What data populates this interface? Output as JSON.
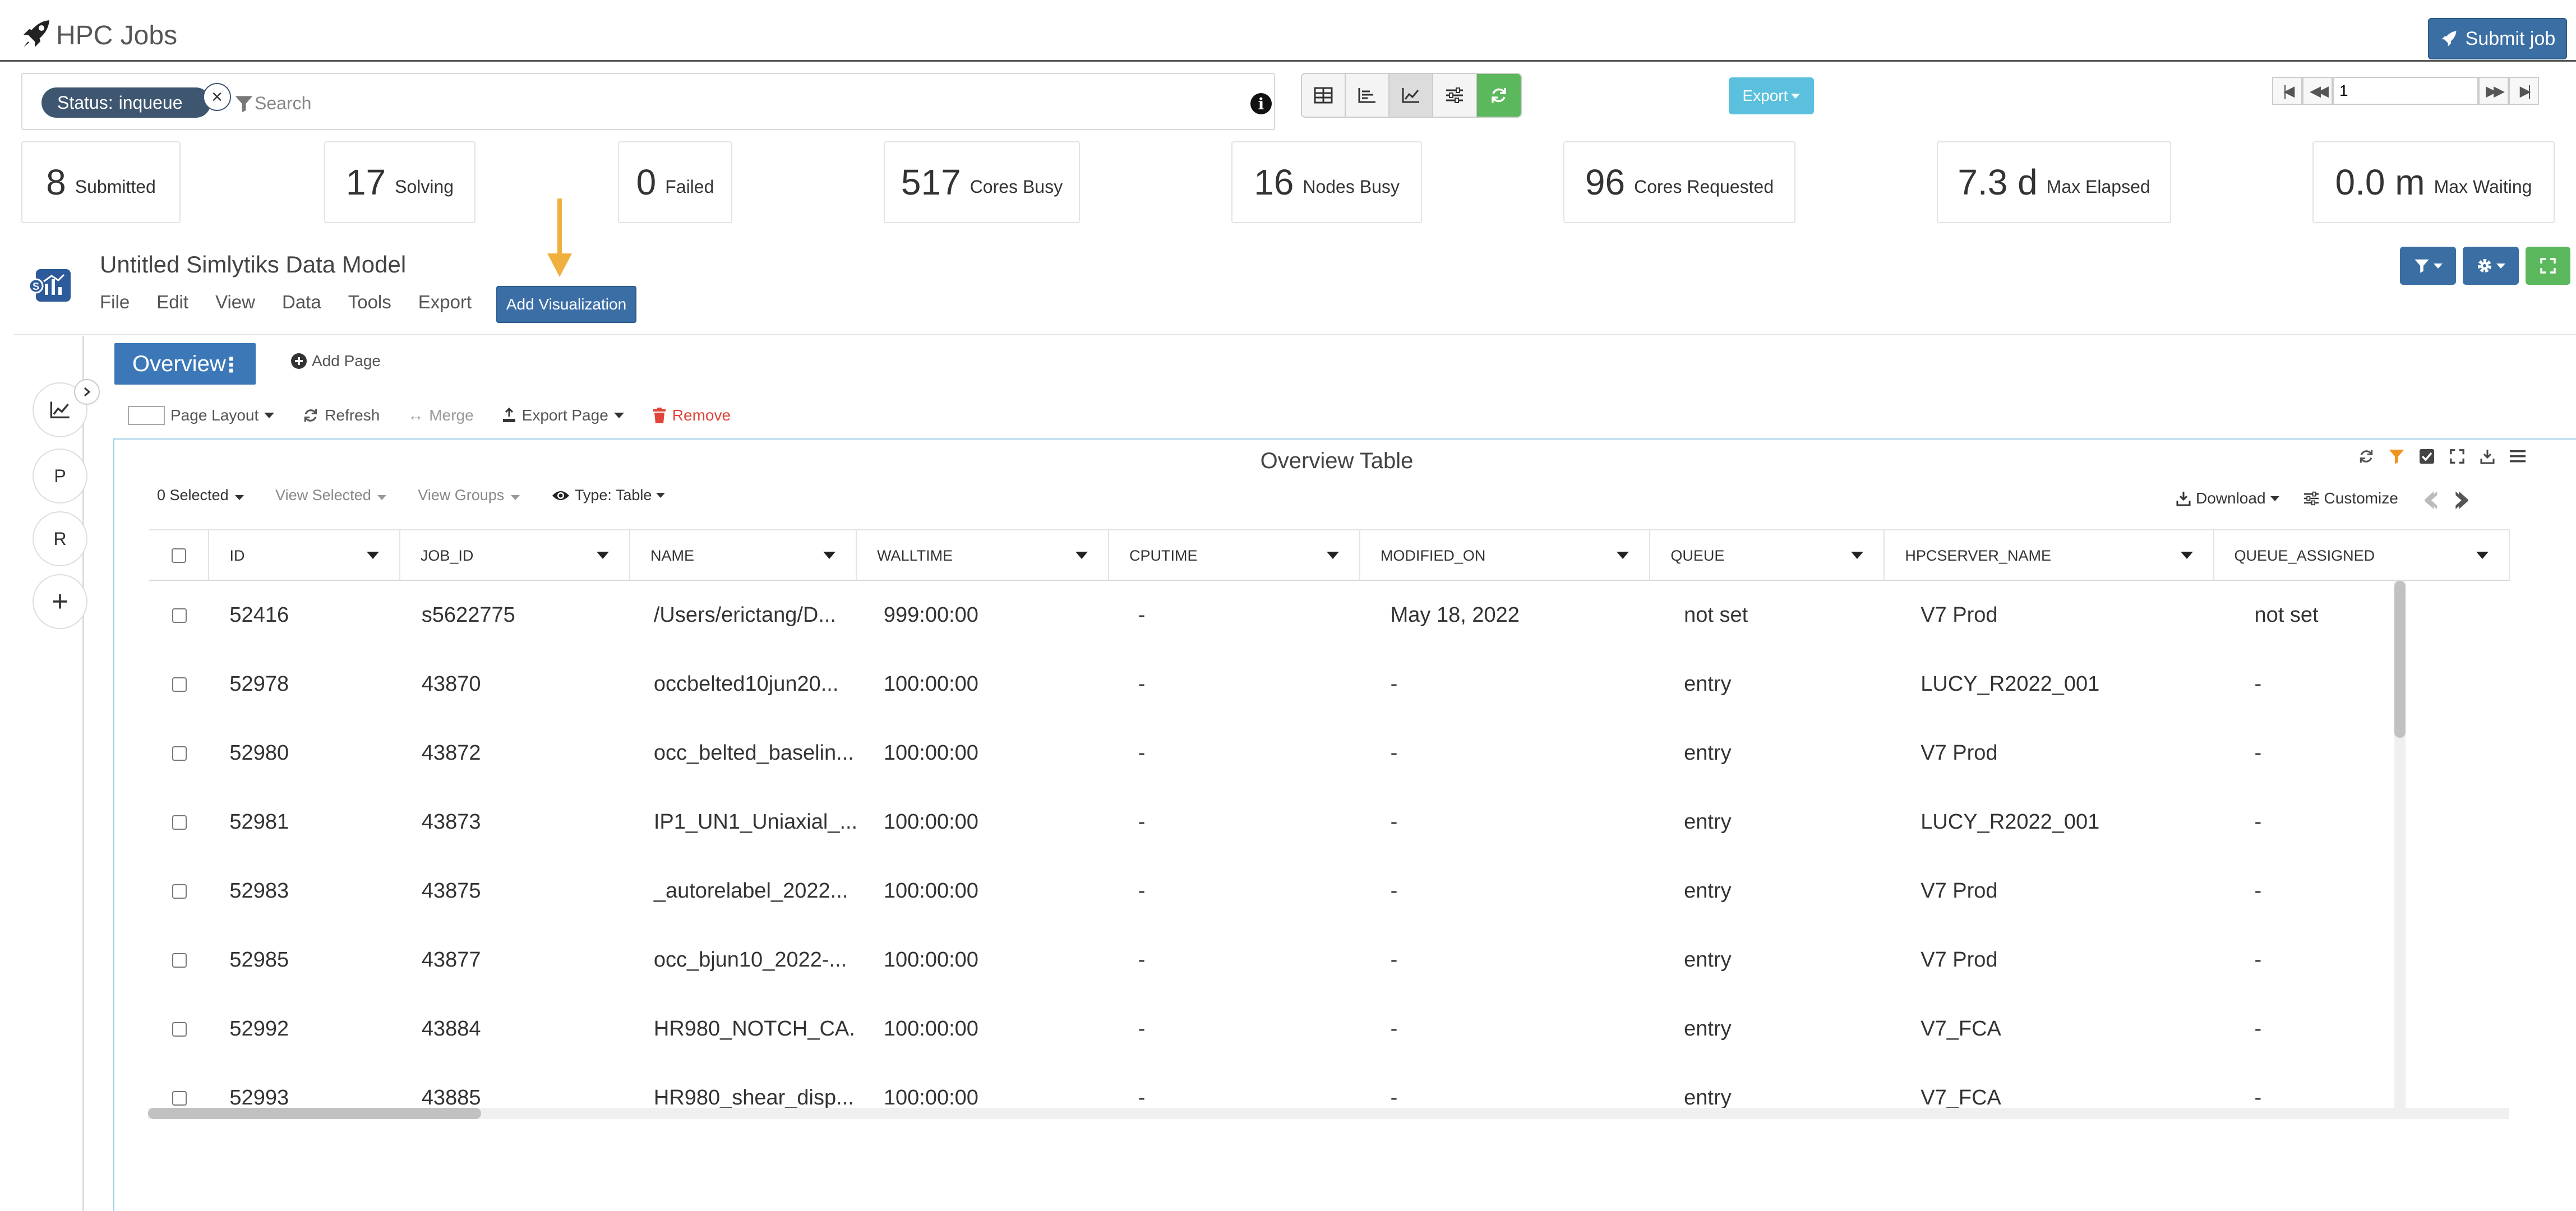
{
  "app": {
    "title": "HPC Jobs",
    "submit_label": "Submit job"
  },
  "search": {
    "chip_key": "Status:",
    "chip_value": "inqueue",
    "chip_close": "×",
    "placeholder": "Search"
  },
  "export": {
    "label": "Export"
  },
  "pager": {
    "page": "1"
  },
  "stats": [
    {
      "value": "8",
      "label": "Submitted"
    },
    {
      "value": "17",
      "label": "Solving"
    },
    {
      "value": "0",
      "label": "Failed"
    },
    {
      "value": "517",
      "label": "Cores Busy"
    },
    {
      "value": "16",
      "label": "Nodes Busy"
    },
    {
      "value": "96",
      "label": "Cores Requested"
    },
    {
      "value": "7.3 d",
      "label": "Max Elapsed"
    },
    {
      "value": "0.0 m",
      "label": "Max Waiting"
    }
  ],
  "model": {
    "title": "Untitled Simlytiks Data Model",
    "menu": [
      "File",
      "Edit",
      "View",
      "Data",
      "Tools",
      "Export"
    ],
    "add_viz": "Add Visualization"
  },
  "rail": {
    "p": "P",
    "r": "R",
    "plus": "+"
  },
  "page": {
    "tab": "Overview",
    "tab_menu": "⋮",
    "add_page": "Add Page",
    "toolbar": {
      "layout": "Page Layout",
      "refresh": "Refresh",
      "merge": "Merge",
      "export_page": "Export Page",
      "remove": "Remove"
    }
  },
  "widget": {
    "title": "Overview Table",
    "selected": "0 Selected",
    "view_selected": "View Selected",
    "view_groups": "View Groups",
    "type": "Type: Table",
    "download": "Download",
    "customize": "Customize"
  },
  "table": {
    "columns": [
      "ID",
      "JOB_ID",
      "NAME",
      "WALLTIME",
      "CPUTIME",
      "MODIFIED_ON",
      "QUEUE",
      "HPCSERVER_NAME",
      "QUEUE_ASSIGNED"
    ],
    "rows": [
      [
        "52416",
        "s5622775",
        "/Users/erictang/D...",
        "999:00:00",
        "-",
        "May 18, 2022",
        "not set",
        "V7 Prod",
        "not set"
      ],
      [
        "52978",
        "43870",
        "occbelted10jun20...",
        "100:00:00",
        "-",
        "-",
        "entry",
        "LUCY_R2022_001",
        "-"
      ],
      [
        "52980",
        "43872",
        "occ_belted_baselin...",
        "100:00:00",
        "-",
        "-",
        "entry",
        "V7 Prod",
        "-"
      ],
      [
        "52981",
        "43873",
        "IP1_UN1_Uniaxial_...",
        "100:00:00",
        "-",
        "-",
        "entry",
        "LUCY_R2022_001",
        "-"
      ],
      [
        "52983",
        "43875",
        "_autorelabel_2022...",
        "100:00:00",
        "-",
        "-",
        "entry",
        "V7 Prod",
        "-"
      ],
      [
        "52985",
        "43877",
        "occ_bjun10_2022-...",
        "100:00:00",
        "-",
        "-",
        "entry",
        "V7 Prod",
        "-"
      ],
      [
        "52992",
        "43884",
        "HR980_NOTCH_CA...",
        "100:00:00",
        "-",
        "-",
        "entry",
        "V7_FCA",
        "-"
      ],
      [
        "52993",
        "43885",
        "HR980_shear_disp...",
        "100:00:00",
        "-",
        "-",
        "entry",
        "V7_FCA",
        "-"
      ]
    ]
  },
  "colors": {
    "primary": "#3b6fa3",
    "accent_arrow": "#f0b040",
    "success": "#5cb85c",
    "info": "#5bc0de",
    "danger": "#e0453a"
  }
}
